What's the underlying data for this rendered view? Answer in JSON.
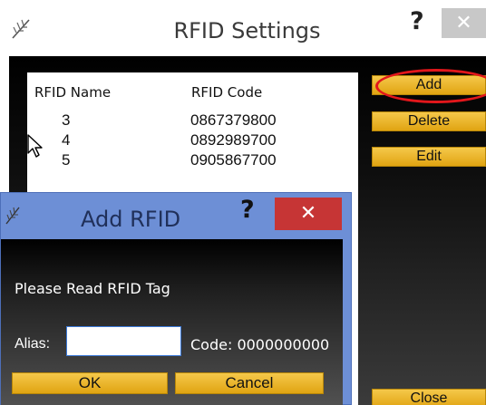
{
  "main_window": {
    "title": "RFID Settings",
    "help_glyph": "?",
    "close_glyph": "✕",
    "icon": "app-feather-icon"
  },
  "rfid_list": {
    "columns": [
      "RFID Name",
      "RFID Code"
    ],
    "rows": [
      {
        "name": "3",
        "code": "0867379800"
      },
      {
        "name": "4",
        "code": "0892989700"
      },
      {
        "name": "5",
        "code": "0905867700"
      }
    ]
  },
  "side_buttons": {
    "add": "Add",
    "delete": "Delete",
    "edit": "Edit",
    "close": "Close"
  },
  "dialog": {
    "title": "Add RFID",
    "help_glyph": "?",
    "close_glyph": "✕",
    "prompt": "Please Read RFID Tag",
    "alias_label": "Alias:",
    "alias_value": "",
    "code_label": "Code: 0000000000",
    "ok": "OK",
    "cancel": "Cancel"
  },
  "colors": {
    "button_gold": "#f0b72c",
    "highlight_red": "#e2171b",
    "dialog_frame": "#6d8fd6",
    "dialog_close": "#c63535"
  }
}
